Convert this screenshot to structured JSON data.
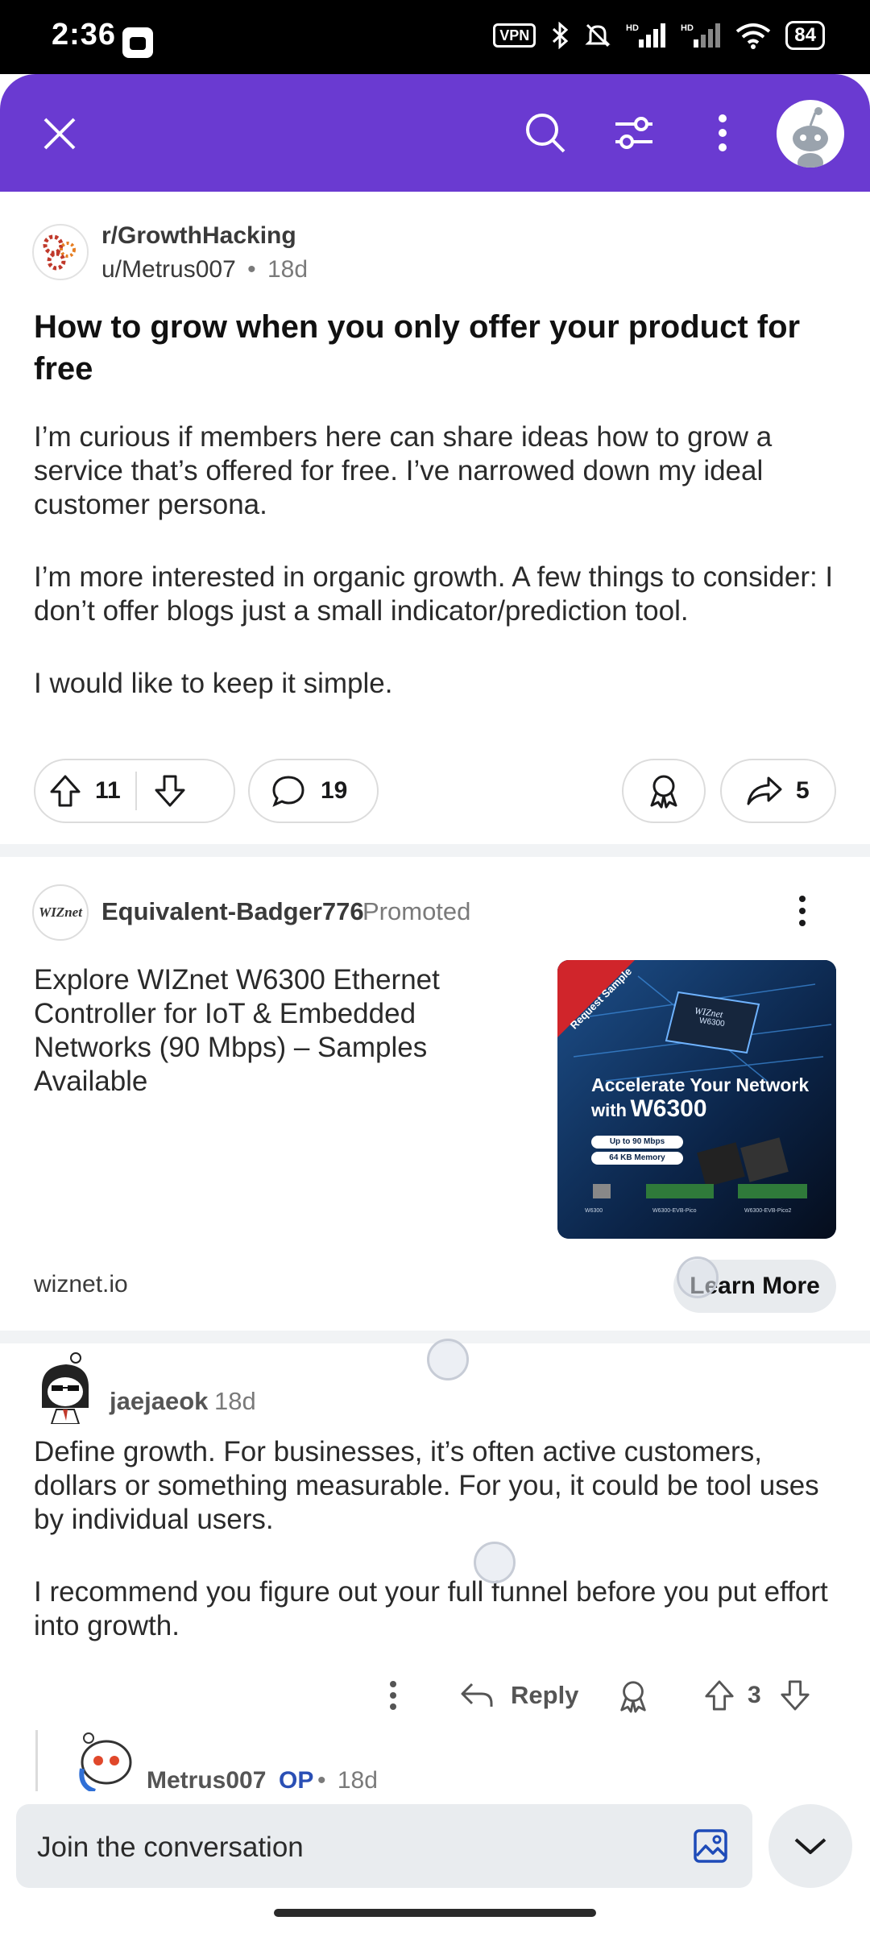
{
  "status_bar": {
    "time": "2:36",
    "vpn": "VPN",
    "battery": "84"
  },
  "top_bar": {
    "bg_color": "#6a3ad1",
    "icons": [
      "close-icon",
      "search-icon",
      "filter-icon",
      "more-vertical-icon",
      "profile-avatar"
    ]
  },
  "post": {
    "subreddit": "r/GrowthHacking",
    "author": "u/Metrus007",
    "separator": "•",
    "age": "18d",
    "title": "How to grow when you only offer your product for free",
    "body": [
      "I’m curious if members here can share ideas how to grow a service that’s offered for free. I’ve narrowed down my ideal customer persona.",
      "I’m more interested in organic growth. A few things to consider: I don’t offer blogs just a small indicator/prediction tool.",
      "I would like to keep it simple."
    ],
    "votes": "11",
    "comments": "19",
    "shares": "5"
  },
  "ad": {
    "logo_text": "WIZnet",
    "advertiser": "Equivalent-Badger776",
    "label": "Promoted",
    "text": "Explore WIZnet W6300 Ethernet Controller for IoT & Embedded Networks (90 Mbps) – Samples Available",
    "domain": "wiznet.io",
    "cta": "Learn More",
    "image": {
      "ribbon": "Request Sample",
      "headline_1": "Accelerate Your Network",
      "headline_2_prefix": "with",
      "headline_2_model": "W6300",
      "spec_1": "Up to 90 Mbps",
      "spec_2": "64 KB Memory",
      "chip_brand": "WIZnet",
      "chip_model": "W6300",
      "board_1": "W6300",
      "board_2": "W6300-EVB-Pico",
      "board_3": "W6300-EVB-Pico2"
    }
  },
  "comment": {
    "user": "jaejaeok",
    "age": "18d",
    "body": [
      "Define growth. For businesses, it’s often active customers, dollars or something measurable. For you, it could be tool uses by individual users.",
      "I recommend you figure out your full funnel before you put effort into growth."
    ],
    "reply_label": "Reply",
    "votes": "3"
  },
  "reply": {
    "user": "Metrus007",
    "op_badge": "OP",
    "separator": "•",
    "age": "18d"
  },
  "compose": {
    "placeholder": "Join the conversation"
  }
}
